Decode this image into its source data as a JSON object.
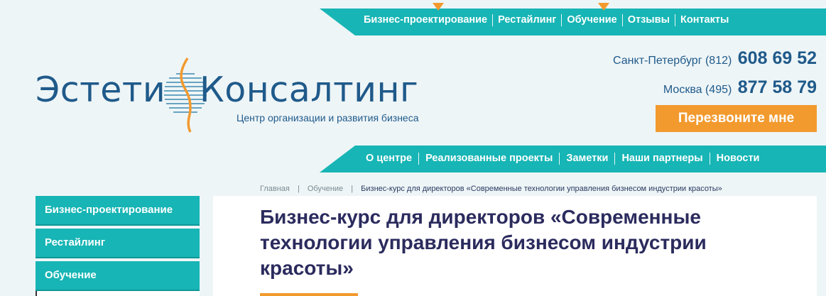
{
  "top_nav": {
    "items": [
      "Бизнес-проектирование",
      "Рестайлинг",
      "Обучение",
      "Отзывы",
      "Контакты"
    ]
  },
  "logo": {
    "word_left": "Эстети",
    "word_right": "Консалтинг",
    "tagline": "Центр организации и развития бизнеса"
  },
  "phones": [
    {
      "city": "Санкт-Петербург (812)",
      "number": "608 69 52"
    },
    {
      "city": "Москва (495)",
      "number": "877 58 79"
    }
  ],
  "callback_label": "Перезвоните мне",
  "sub_nav": {
    "items": [
      "О центре",
      "Реализованные проекты",
      "Заметки",
      "Наши партнеры",
      "Новости"
    ]
  },
  "sidebar": {
    "items": [
      "Бизнес-проектирование",
      "Рестайлинг",
      "Обучение"
    ]
  },
  "breadcrumb": {
    "home": "Главная",
    "section": "Обучение",
    "current": "Бизнес-курс для директоров «Современные технологии управления бизнесом индустрии красоты»",
    "separator": "|"
  },
  "page_title": "Бизнес-курс для директоров «Современные технологии управления бизнесом индустрии красоты»",
  "colors": {
    "teal": "#17b5b5",
    "orange": "#f29a2e",
    "navy": "#1f5a8a",
    "title": "#2b2b5e"
  }
}
